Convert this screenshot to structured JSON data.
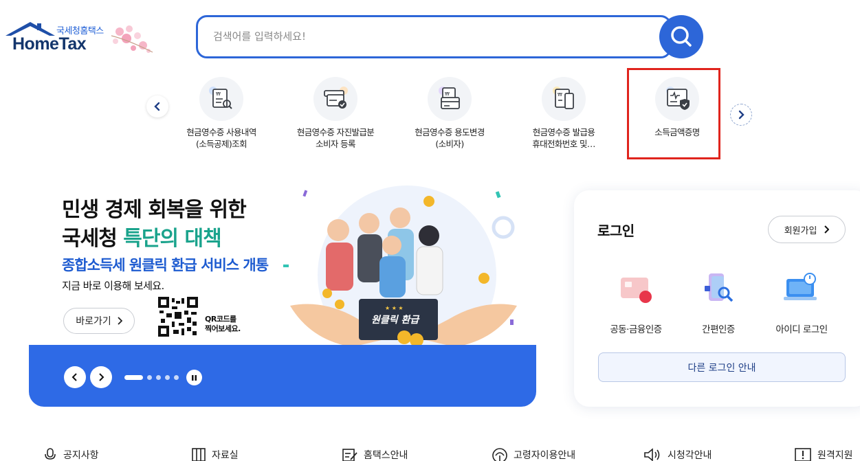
{
  "header": {
    "logo_sub": "국세청홈택스",
    "logo_main": "HomeTax",
    "search_placeholder": "검색어를 입력하세요!",
    "search_icon": "search-icon"
  },
  "quick_menu": {
    "items": [
      {
        "label": "현금영수증 사용내역\n(소득공제)조회",
        "icon": "receipt-search-icon"
      },
      {
        "label": "현금영수증 자진발급분\n소비자 등록",
        "icon": "receipt-card-check-icon"
      },
      {
        "label": "현금영수증 용도변경\n(소비자)",
        "icon": "receipt-card-icon"
      },
      {
        "label": "현금영수증 발급용\n휴대전화번호 및…",
        "icon": "receipt-phone-icon"
      },
      {
        "label": "소득금액증명",
        "icon": "income-certificate-icon"
      }
    ]
  },
  "banner": {
    "line1": "민생 경제 회복을 위한",
    "line2_prefix": "국세청 ",
    "line2_accent": "특단의 대책",
    "subtitle": "종합소득세 원클릭 환급 서비스 개통",
    "desc": "지금 바로 이용해 보세요.",
    "button": "바로가기",
    "qr_text": "QR코드를\n찍어보세요.",
    "sign_text": "원클릭 환급"
  },
  "login": {
    "title": "로그인",
    "join": "회원가입",
    "options": [
      {
        "label": "공동·금융인증",
        "icon": "certificate-card-icon"
      },
      {
        "label": "간편인증",
        "icon": "simple-auth-icon"
      },
      {
        "label": "아이디 로그인",
        "icon": "id-login-icon"
      }
    ],
    "other": "다른 로그인 안내"
  },
  "bottom_links": [
    {
      "label": "공지사항",
      "icon": "notice-icon"
    },
    {
      "label": "자료실",
      "icon": "archive-icon"
    },
    {
      "label": "홈택스안내",
      "icon": "guide-icon"
    },
    {
      "label": "고령자이용안내",
      "icon": "senior-icon"
    },
    {
      "label": "시청각안내",
      "icon": "audio-visual-icon"
    },
    {
      "label": "원격지원",
      "icon": "remote-support-icon"
    }
  ],
  "colors": {
    "primary": "#2d66d8",
    "banner_bar": "#2e6ae6",
    "accent_green": "#1aa38c",
    "highlight": "#e0241d"
  }
}
